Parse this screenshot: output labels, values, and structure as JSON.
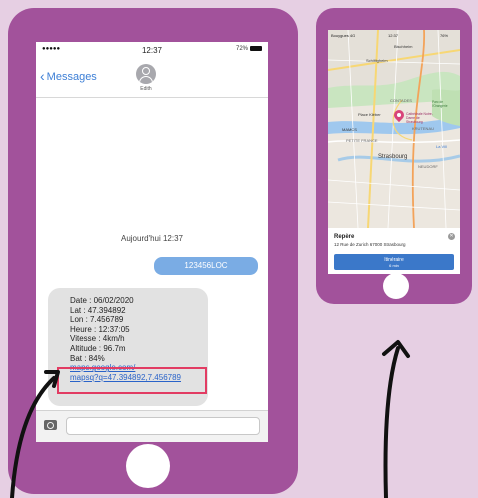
{
  "colors": {
    "background": "#e6cfe3",
    "phone": "#a2529b",
    "bubble_out": "#7aace4",
    "bubble_in": "#e2e2e2",
    "link": "#2a63c9",
    "highlight": "#e23c63",
    "accent_blue": "#3d7fd6"
  },
  "messages_screen": {
    "status_bar": {
      "signal": "●●●●● ",
      "time": "12:37",
      "battery": "72%"
    },
    "nav": {
      "back_label": "Messages",
      "contact_name": "Edith"
    },
    "date_separator": "Aujourd'hui 12:37",
    "outgoing_message": "123456LOC",
    "incoming_message": {
      "lines": [
        "Date : 06/02/2020",
        "Lat : 47.394892",
        "Lon : 7.456789",
        "Heure : 12:37:05",
        "Vitesse : 4km/h",
        "Altitude : 96.7m",
        "Bat : 84%"
      ],
      "link_line1": "maps.google.com/",
      "link_line2": "mapsq?q=47.394892,7.456789"
    },
    "input": {
      "placeholder": ""
    }
  },
  "map_screen": {
    "status_bar": {
      "carrier": "Bouygues 4G",
      "time": "12:37",
      "battery": "76%"
    },
    "labels": {
      "schiltigheim": "Schiltigheim",
      "bischheim": "Bischheim",
      "contades": "CONTADES",
      "orangerie": "Parc de l'Orangerie",
      "place_kleber": "Place Kléber",
      "cathedrale": "Cathédrale Notre-Dame de Strasbourg",
      "mamcs": "MAMCS",
      "petite_france": "PETITE FRANCE",
      "krutenau": "KRUTENAU",
      "strasbourg": "Strasbourg",
      "neudorf": "NEUDORF",
      "la_vill": "La Vill"
    },
    "card": {
      "title": "Repère",
      "address": "12 Rue de Zurich 67000 Strasbourg",
      "route_label": "Itinéraire",
      "route_time": "6 min"
    }
  }
}
